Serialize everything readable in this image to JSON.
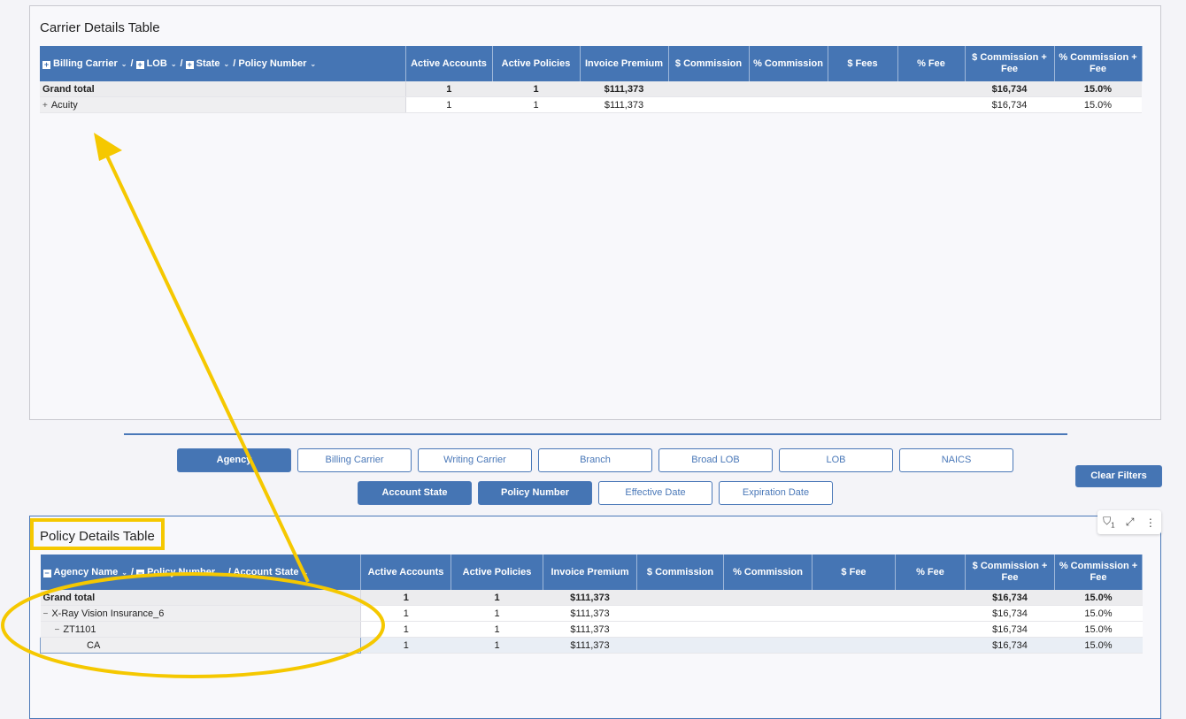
{
  "carrier_panel": {
    "title": "Carrier Details Table",
    "row_header": [
      {
        "label": "Billing Carrier",
        "icon": "plus"
      },
      {
        "label": "LOB",
        "icon": "plus"
      },
      {
        "label": "State",
        "icon": "plus"
      },
      {
        "label": "Policy Number",
        "icon": "none"
      }
    ],
    "columns": [
      "Active Accounts",
      "Active Policies",
      "Invoice Premium",
      "$ Commission",
      "% Commission",
      "$ Fees",
      "% Fee",
      "$ Commission + Fee",
      "% Commission + Fee"
    ],
    "rows": [
      {
        "type": "total",
        "toggle": "",
        "level": 0,
        "cells": [
          "Grand total",
          "1",
          "1",
          "$111,373",
          "",
          "",
          "",
          "",
          "$16,734",
          "15.0%"
        ]
      },
      {
        "type": "row",
        "toggle": "+",
        "level": 0,
        "cells": [
          "Acuity",
          "1",
          "1",
          "$111,373",
          "",
          "",
          "",
          "",
          "$16,734",
          "15.0%"
        ]
      }
    ]
  },
  "filters": {
    "row1": [
      {
        "label": "Agency",
        "active": true
      },
      {
        "label": "Billing Carrier",
        "active": false
      },
      {
        "label": "Writing Carrier",
        "active": false
      },
      {
        "label": "Branch",
        "active": false
      },
      {
        "label": "Broad LOB",
        "active": false
      },
      {
        "label": "LOB",
        "active": false
      },
      {
        "label": "NAICS",
        "active": false
      }
    ],
    "row2": [
      {
        "label": "Account State",
        "active": true
      },
      {
        "label": "Policy Number",
        "active": true
      },
      {
        "label": "Effective Date",
        "active": false
      },
      {
        "label": "Expiration Date",
        "active": false
      }
    ],
    "clear_label": "Clear Filters"
  },
  "policy_panel": {
    "title": "Policy Details Table",
    "toolbar": {
      "filter_count": "1",
      "icons": [
        "filter-icon",
        "expand-icon",
        "more-vertical-icon"
      ]
    },
    "row_header": [
      {
        "label": "Agency Name",
        "icon": "minus"
      },
      {
        "label": "Policy Number",
        "icon": "minus"
      },
      {
        "label": "Account State",
        "icon": "none"
      }
    ],
    "columns": [
      "Active Accounts",
      "Active Policies",
      "Invoice Premium",
      "$ Commission",
      "% Commission",
      "$ Fee",
      "% Fee",
      "$ Commission + Fee",
      "% Commission + Fee"
    ],
    "rows": [
      {
        "type": "total",
        "toggle": "",
        "level": 0,
        "cells": [
          "Grand total",
          "1",
          "1",
          "$111,373",
          "",
          "",
          "",
          "",
          "$16,734",
          "15.0%"
        ]
      },
      {
        "type": "row",
        "toggle": "−",
        "level": 0,
        "cells": [
          "X-Ray Vision Insurance_6",
          "1",
          "1",
          "$111,373",
          "",
          "",
          "",
          "",
          "$16,734",
          "15.0%"
        ]
      },
      {
        "type": "row",
        "toggle": "−",
        "level": 1,
        "cells": [
          "ZT1101",
          "1",
          "1",
          "$111,373",
          "",
          "",
          "",
          "",
          "$16,734",
          "15.0%"
        ]
      },
      {
        "type": "sel",
        "toggle": "",
        "level": 2,
        "cells": [
          "CA",
          "1",
          "1",
          "$111,373",
          "",
          "",
          "",
          "",
          "$16,734",
          "15.0%"
        ]
      }
    ]
  },
  "annotation": {
    "color": "#f5c800"
  }
}
